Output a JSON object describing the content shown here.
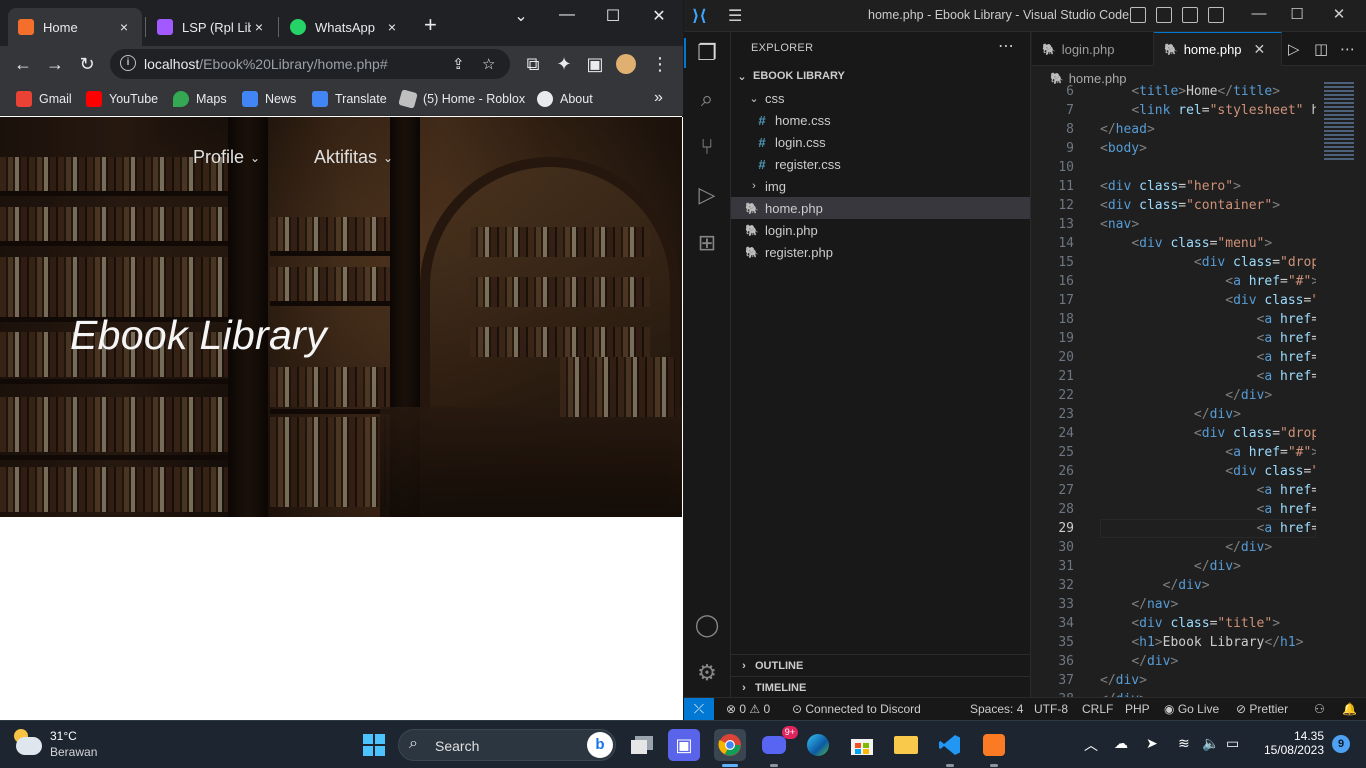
{
  "chrome": {
    "tabs": [
      {
        "title": "Home",
        "favicon_color": "#f36f2b",
        "active": true
      },
      {
        "title": "LSP (Rpl Libra",
        "favicon_color": "#a259ff",
        "active": false
      },
      {
        "title": "WhatsApp",
        "favicon_color": "#25d366",
        "active": false
      }
    ],
    "close_glyph": "×",
    "new_tab_glyph": "+",
    "address": {
      "host": "localhost",
      "path": "/Ebook%20Library/home.php#"
    },
    "bookmarks": [
      {
        "label": "Gmail",
        "icon": "gmail-icon",
        "color": "#ea4335"
      },
      {
        "label": "YouTube",
        "icon": "youtube-icon",
        "color": "#ff0000"
      },
      {
        "label": "Maps",
        "icon": "maps-icon",
        "color": "#34a853"
      },
      {
        "label": "News",
        "icon": "news-icon",
        "color": "#4285f4"
      },
      {
        "label": "Translate",
        "icon": "translate-icon",
        "color": "#4285f4"
      },
      {
        "label": "(5) Home - Roblox",
        "icon": "roblox-icon",
        "color": "#bfbfbf"
      },
      {
        "label": "About",
        "icon": "globe-icon",
        "color": "#e8eaed"
      }
    ],
    "bookmarks_overflow": "»",
    "page": {
      "nav": [
        {
          "label": "Profile"
        },
        {
          "label": "Aktifitas"
        }
      ],
      "hero_title": "Ebook Library"
    }
  },
  "vscode": {
    "window_title": "home.php - Ebook Library - Visual Studio Code",
    "explorer_header": "EXPLORER",
    "project_root": "EBOOK LIBRARY",
    "tree": [
      {
        "label": "css",
        "type": "folder-open",
        "depth": 1
      },
      {
        "label": "home.css",
        "type": "css",
        "depth": 2
      },
      {
        "label": "login.css",
        "type": "css",
        "depth": 2
      },
      {
        "label": "register.css",
        "type": "css",
        "depth": 2
      },
      {
        "label": "img",
        "type": "folder-closed",
        "depth": 1
      },
      {
        "label": "home.php",
        "type": "php",
        "depth": 1,
        "selected": true
      },
      {
        "label": "login.php",
        "type": "php",
        "depth": 1
      },
      {
        "label": "register.php",
        "type": "php",
        "depth": 1
      }
    ],
    "sections": [
      "OUTLINE",
      "TIMELINE"
    ],
    "editor_tabs": [
      {
        "label": "login.php",
        "active": false
      },
      {
        "label": "home.php",
        "active": true
      }
    ],
    "breadcrumb": "home.php",
    "current_line": 29,
    "code_lines": [
      {
        "n": 6,
        "text": "    <title>Home</title>"
      },
      {
        "n": 7,
        "text": "    <link rel=\"stylesheet\" hr"
      },
      {
        "n": 8,
        "text": "</head>"
      },
      {
        "n": 9,
        "text": "<body>"
      },
      {
        "n": 10,
        "text": ""
      },
      {
        "n": 11,
        "text": "<div class=\"hero\">"
      },
      {
        "n": 12,
        "text": "<div class=\"container\">"
      },
      {
        "n": 13,
        "text": "<nav>"
      },
      {
        "n": 14,
        "text": "    <div class=\"menu\">"
      },
      {
        "n": 15,
        "text": "            <div class=\"dropd"
      },
      {
        "n": 16,
        "text": "                <a href=\"#\">P"
      },
      {
        "n": 17,
        "text": "                <div class=\"c"
      },
      {
        "n": 18,
        "text": "                    <a href="
      },
      {
        "n": 19,
        "text": "                    <a href="
      },
      {
        "n": 20,
        "text": "                    <a href="
      },
      {
        "n": 21,
        "text": "                    <a href="
      },
      {
        "n": 22,
        "text": "                </div>"
      },
      {
        "n": 23,
        "text": "            </div>"
      },
      {
        "n": 24,
        "text": "            <div class=\"dropd"
      },
      {
        "n": 25,
        "text": "                <a href=\"#\">A"
      },
      {
        "n": 26,
        "text": "                <div class=\"c"
      },
      {
        "n": 27,
        "text": "                    <a href="
      },
      {
        "n": 28,
        "text": "                    <a href="
      },
      {
        "n": 29,
        "text": "                    <a href="
      },
      {
        "n": 30,
        "text": "                </div>"
      },
      {
        "n": 31,
        "text": "            </div>"
      },
      {
        "n": 32,
        "text": "        </div>"
      },
      {
        "n": 33,
        "text": "    </nav>"
      },
      {
        "n": 34,
        "text": "    <div class=\"title\">"
      },
      {
        "n": 35,
        "text": "    <h1>Ebook Library</h1>"
      },
      {
        "n": 36,
        "text": "    </div>"
      },
      {
        "n": 37,
        "text": "</div>"
      },
      {
        "n": 38,
        "text": "</div>"
      }
    ],
    "status": {
      "errors": "0",
      "warnings": "0",
      "discord": "Connected to Discord",
      "spaces": "Spaces: 4",
      "encoding": "UTF-8",
      "eol": "CRLF",
      "language": "PHP",
      "golive": "Go Live",
      "prettier": "Prettier"
    }
  },
  "taskbar": {
    "temperature": "31°C",
    "condition": "Berawan",
    "search_label": "Search",
    "discord_badge": "9+",
    "time": "14.35",
    "date": "15/08/2023",
    "notifications": "9"
  }
}
